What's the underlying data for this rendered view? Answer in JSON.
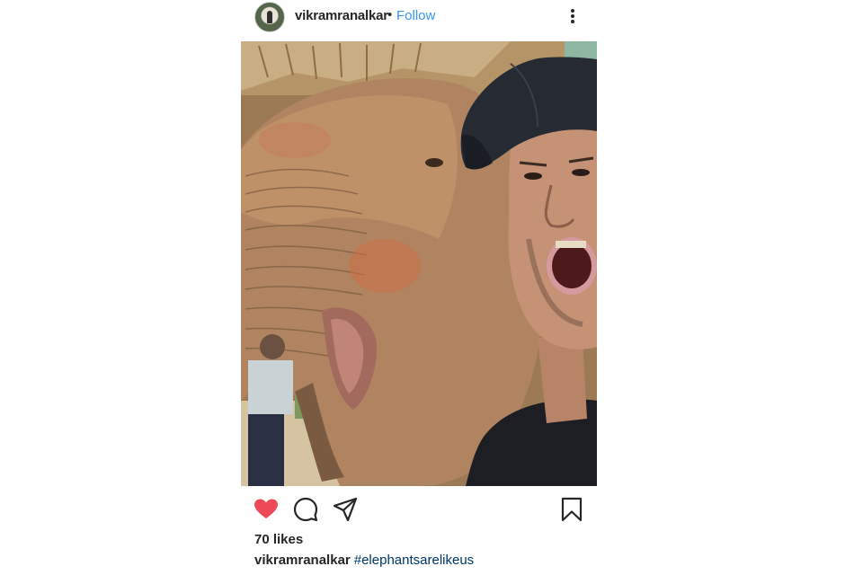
{
  "header": {
    "username": "vikramranalkar",
    "separator": "•",
    "follow_label": "Follow",
    "more_icon": "more-vertical-icon"
  },
  "post": {
    "image_icon": "photo",
    "liked": true,
    "colors": {
      "like": "#ed4956",
      "follow": "#3897f0",
      "hashtag": "#003569",
      "text": "#262626"
    }
  },
  "actions": {
    "like_icon": "heart-icon",
    "comment_icon": "comment-icon",
    "share_icon": "share-icon",
    "save_icon": "bookmark-icon"
  },
  "likes": {
    "text": "70 likes"
  },
  "caption": {
    "username": "vikramranalkar",
    "hashtag": "#elephantsarelikeus"
  }
}
